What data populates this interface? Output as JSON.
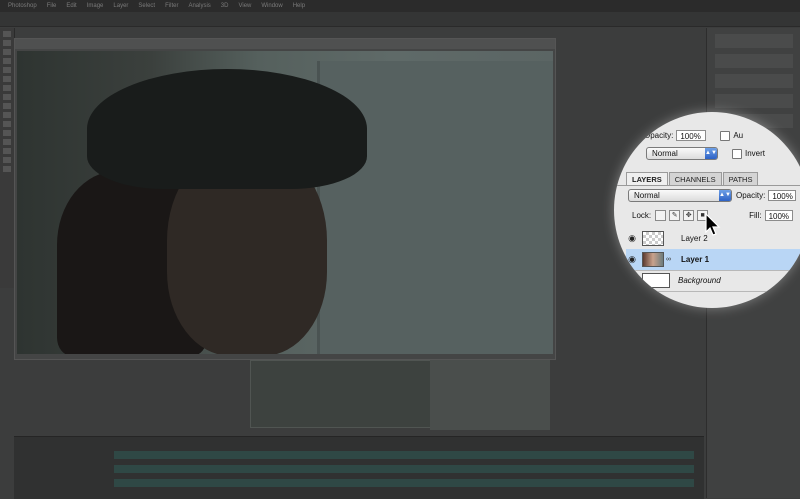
{
  "menubar": {
    "items": [
      "Photoshop",
      "File",
      "Edit",
      "Image",
      "Layer",
      "Select",
      "Filter",
      "Analysis",
      "3D",
      "View",
      "Window",
      "Help"
    ]
  },
  "magnifier": {
    "top_opacity_label": "Opacity:",
    "top_opacity_value": "100%",
    "top_blend_mode": "Normal",
    "auto_label": "Au",
    "invert_label": "Invert",
    "tabs": [
      {
        "label": "LAYERS",
        "active": true
      },
      {
        "label": "CHANNELS",
        "active": false
      },
      {
        "label": "PATHS",
        "active": false
      }
    ],
    "blend_mode": "Normal",
    "opacity_label": "Opacity:",
    "opacity_value": "100%",
    "lock_label": "Lock:",
    "fill_label": "Fill:",
    "fill_value": "100%",
    "layers": [
      {
        "name": "Layer 2",
        "selected": false,
        "thumb": "transparent",
        "visible_icon": "eye-icon"
      },
      {
        "name": "Layer 1",
        "selected": true,
        "thumb": "photo",
        "visible_icon": "eye-icon"
      },
      {
        "name": "Background",
        "selected": false,
        "thumb": "white",
        "visible_icon": "eye-icon"
      }
    ]
  },
  "colors": {
    "selection": "#b9d6f5",
    "accent": "#2d62c5"
  }
}
